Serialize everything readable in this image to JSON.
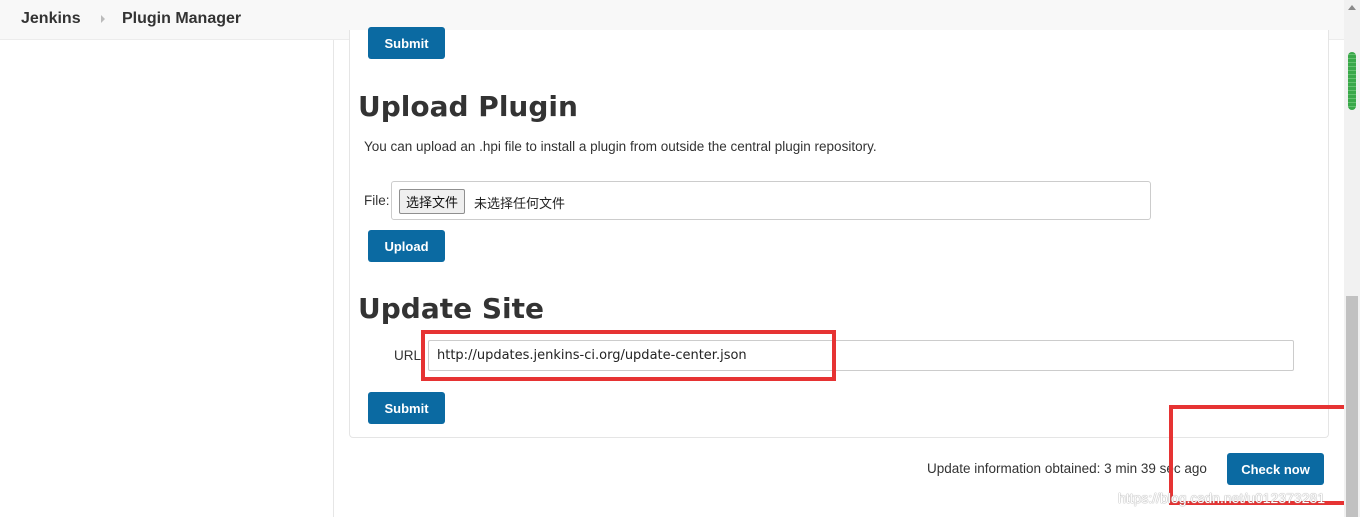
{
  "breadcrumb": {
    "items": [
      "Jenkins",
      "Plugin Manager"
    ]
  },
  "top_submit_label": "Submit",
  "upload": {
    "title": "Upload Plugin",
    "description": "You can upload an .hpi file to install a plugin from outside the central plugin repository.",
    "file_label": "File:",
    "choose_file_label": "选择文件",
    "no_file_text": "未选择任何文件",
    "upload_button": "Upload"
  },
  "update_site": {
    "title": "Update Site",
    "url_label": "URL",
    "url_value": "http://updates.jenkins-ci.org/update-center.json",
    "submit_label": "Submit"
  },
  "status": {
    "text": "Update information obtained: 3 min 39 sec ago",
    "check_now_label": "Check now"
  },
  "watermark": "https://blog.csdn.net/u012373281",
  "colors": {
    "primary_button": "#0b6aa2",
    "annotation_red": "#e63333",
    "scroll_thumb": "#3aa84a"
  }
}
